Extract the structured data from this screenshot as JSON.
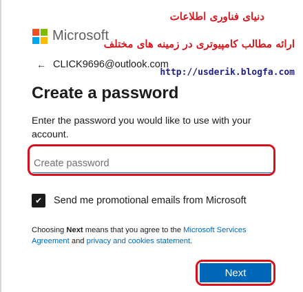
{
  "brand": {
    "name": "Microsoft",
    "logo_colors": [
      "#f25022",
      "#7fba00",
      "#00a4ef",
      "#ffb900"
    ]
  },
  "watermark": {
    "line1": "دنیای فناوری اطلاعات",
    "line2": "ارائه مطالب کامپیوتری در زمینه های مختلف",
    "url": "http://usderik.blogfa.com"
  },
  "identity": {
    "back_icon": "←",
    "email": "CLICK9696@outlook.com"
  },
  "page": {
    "title": "Create a password",
    "description": "Enter the password you would like to use with your account."
  },
  "password_field": {
    "placeholder": "Create password",
    "value": ""
  },
  "promo_checkbox": {
    "checked": true,
    "check_glyph": "✔",
    "label": "Send me promotional emails from Microsoft"
  },
  "terms": {
    "prefix": "Choosing ",
    "bold": "Next",
    "middle": " means that you agree to the ",
    "link1": "Microsoft Services Agreement",
    "and": " and ",
    "link2": "privacy and cookies statement",
    "suffix": "."
  },
  "actions": {
    "next_label": "Next"
  },
  "colors": {
    "accent": "#0067b8",
    "highlight": "#d80f1c"
  }
}
